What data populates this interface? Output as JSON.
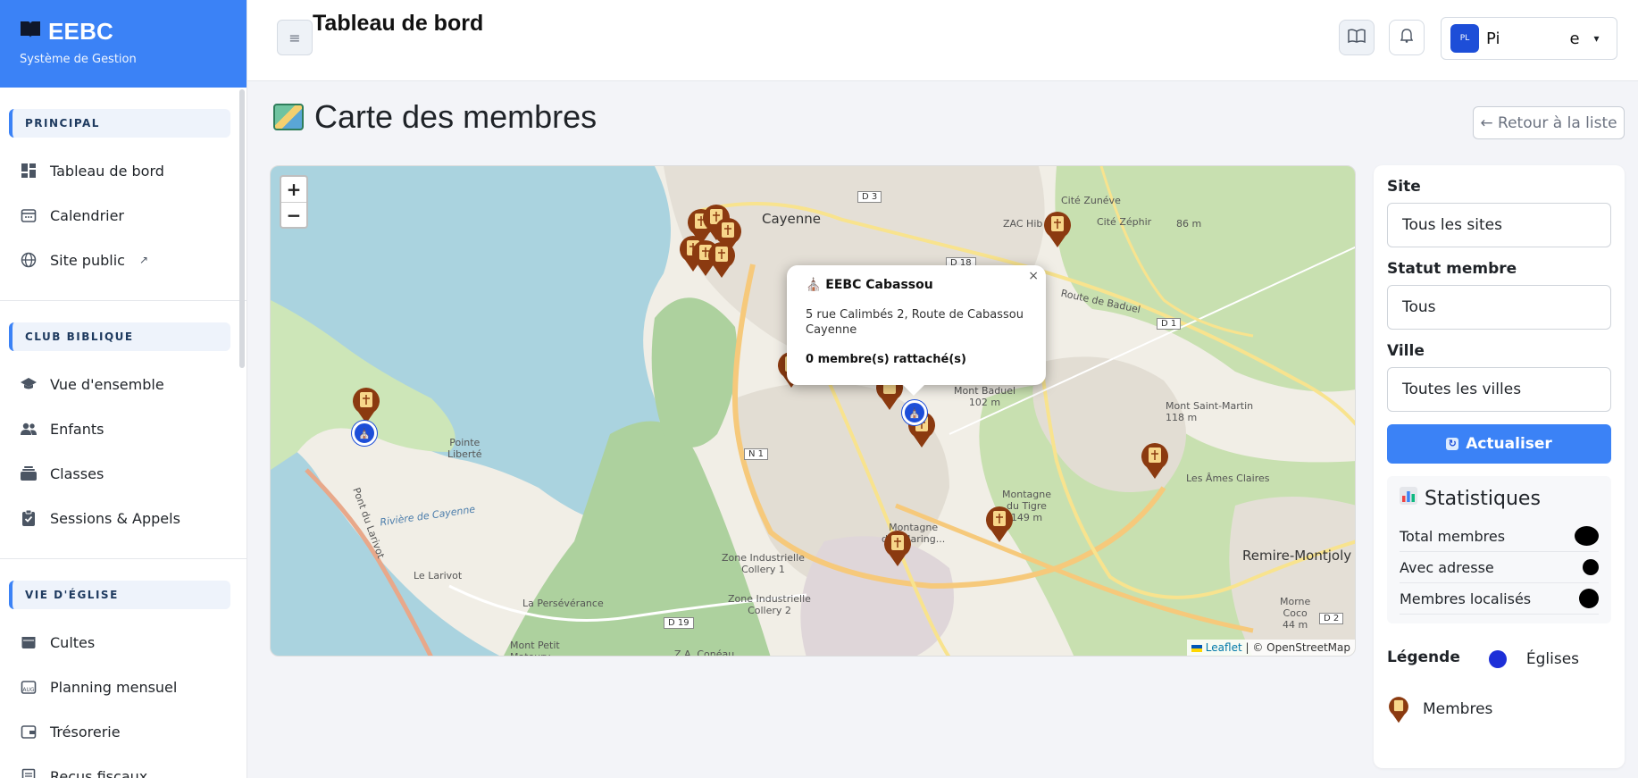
{
  "brand": {
    "name": "EEBC",
    "subtitle": "Système de Gestion"
  },
  "sidebar": {
    "sections": [
      {
        "title": "PRINCIPAL",
        "items": [
          {
            "label": "Tableau de bord",
            "icon": "dashboard-icon"
          },
          {
            "label": "Calendrier",
            "icon": "calendar-icon"
          },
          {
            "label": "Site public",
            "icon": "globe-icon"
          }
        ]
      },
      {
        "title": "CLUB BIBLIQUE",
        "items": [
          {
            "label": "Vue d'ensemble",
            "icon": "graduation-cap-icon"
          },
          {
            "label": "Enfants",
            "icon": "users-icon"
          },
          {
            "label": "Classes",
            "icon": "layers-icon"
          },
          {
            "label": "Sessions & Appels",
            "icon": "clipboard-check-icon"
          }
        ]
      },
      {
        "title": "VIE D'ÉGLISE",
        "items": [
          {
            "label": "Cultes",
            "icon": "calendar-check-icon"
          },
          {
            "label": "Planning mensuel",
            "icon": "calendar-month-icon"
          },
          {
            "label": "Trésorerie",
            "icon": "wallet-icon"
          },
          {
            "label": "Reçus fiscaux",
            "icon": "receipt-icon"
          }
        ]
      }
    ]
  },
  "topbar": {
    "title": "Tableau de bord",
    "user_initials": "PL",
    "user_name_start": "Pi",
    "user_name_end": "e"
  },
  "page": {
    "title": "Carte des membres",
    "back_button": "← Retour à la liste"
  },
  "map": {
    "zoom_in": "+",
    "zoom_out": "−",
    "labels": {
      "cayenne": "Cayenne",
      "cite_zunevue": "Cité Zunéve",
      "cite_zephir": "Cité Zéphir",
      "zac_hib": "ZAC Hib",
      "d3": "D 3",
      "d18": "D 18",
      "d1": "D 1",
      "n1": "N 1",
      "d19": "D 19",
      "d2": "D 2",
      "route_baduel": "Route de Baduel",
      "mont_baduel": "Mont Baduel\n102 m",
      "mont_saint_martin": "Mont Saint-Martin\n118 m",
      "pointe_liberte": "Pointe\nLiberté",
      "les_ames_claires": "Les Âmes Claires",
      "remire": "Remire-Montjoly",
      "riviere": "Rivière de Cayenne",
      "le_larivot": "Le Larivot",
      "la_perseverance": "La Persévérance",
      "zi_collery1": "Zone Industrielle\nCollery 1",
      "zi_collery2": "Zone Industrielle\nCollery 2",
      "montagne_tigre": "Montagne\ndu Tigre\n149 m",
      "morne_coco": "Morne\nCoco\n44 m",
      "m86": "86 m",
      "mont_petit": "Mont Petit\nMatoury",
      "za_coneau": "Z.A. Conéau",
      "pont_larivot": "Pont du Larivot",
      "montagne_maringouins": "Montagne\ndes Maring..."
    },
    "popup": {
      "title": "⛪ EEBC Cabassou",
      "address": "5 rue Calimbés 2, Route de Cabassou\nCayenne",
      "count": "0 membre(s) rattaché(s)",
      "close": "×"
    },
    "attribution_leaflet": "Leaflet",
    "attribution_osm": "| © OpenStreetMap"
  },
  "filters": {
    "site_label": "Site",
    "site_value": "Tous les sites",
    "statut_label": "Statut membre",
    "statut_value": "Tous",
    "ville_label": "Ville",
    "ville_value": "Toutes les villes",
    "refresh_label": "Actualiser"
  },
  "stats": {
    "title": "Statistiques",
    "rows": [
      {
        "label": "Total membres"
      },
      {
        "label": "Avec adresse"
      },
      {
        "label": "Membres localisés"
      }
    ]
  },
  "legend": {
    "label": "Légende",
    "churches": "Églises",
    "members": "Membres"
  },
  "colors": {
    "primary": "#3b82f6",
    "church_marker": "#1d4ed8",
    "member_marker": "#8b3a10"
  }
}
